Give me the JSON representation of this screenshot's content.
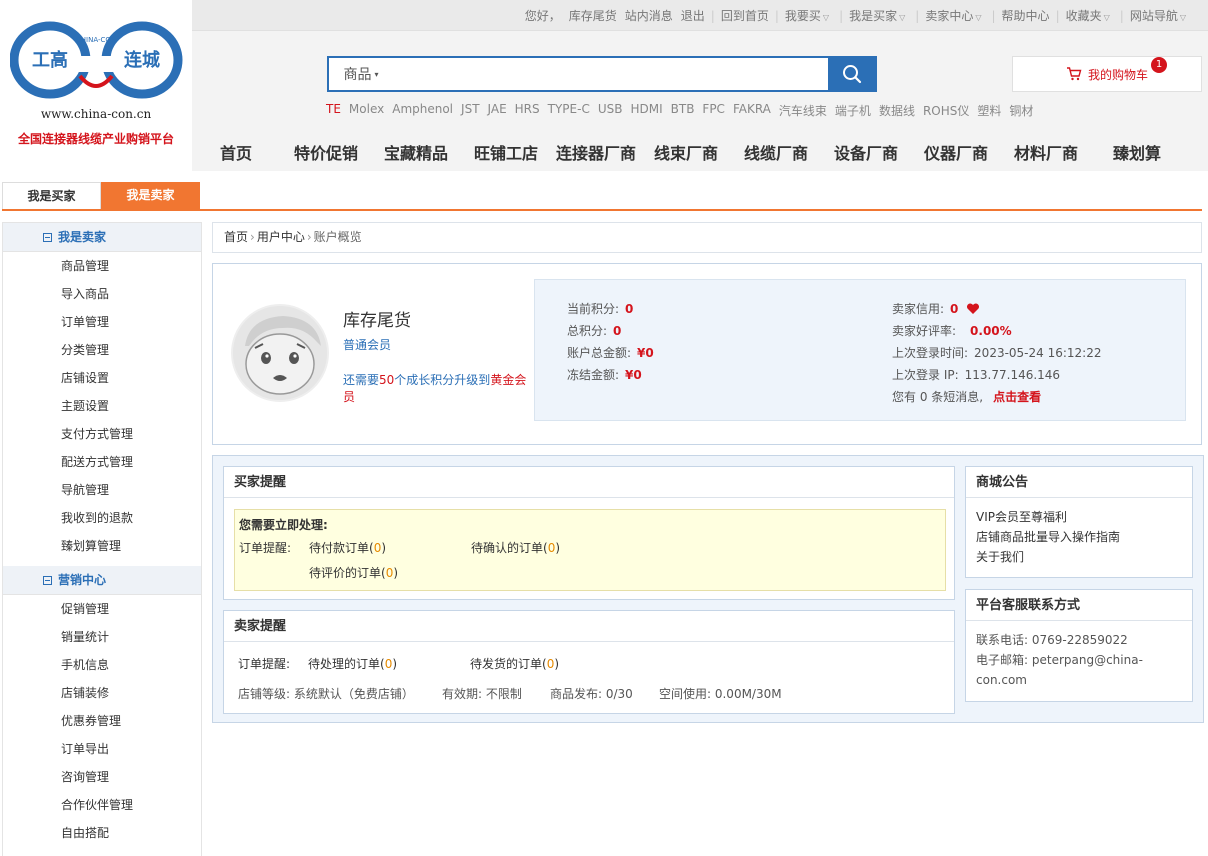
{
  "topbar": {
    "greeting": "您好，",
    "username": "库存尾货",
    "messages": "站内消息",
    "logout": "退出",
    "home": "回到首页",
    "want_buy": "我要买",
    "i_am_buyer": "我是买家",
    "seller_center": "卖家中心",
    "help": "帮助中心",
    "favorites": "收藏夹",
    "site_nav": "网站导航"
  },
  "logo": {
    "left_text": "工高",
    "mid_text": "CHINA-CON",
    "right_text": "连城",
    "url": "www.china-con.cn",
    "slogan": "全国连接器线缆产业购销平台",
    "colors": {
      "blue": "#2b6fb6",
      "red": "#d4141c"
    }
  },
  "search": {
    "category": "商品",
    "placeholder": "",
    "icon": "search-icon"
  },
  "hot_keywords": [
    "TE",
    "Molex",
    "Amphenol",
    "JST",
    "JAE",
    "HRS",
    "TYPE-C",
    "USB",
    "HDMI",
    "BTB",
    "FPC",
    "FAKRA",
    "汽车线束",
    "端子机",
    "数据线",
    "ROHS仪",
    "塑料",
    "铜材"
  ],
  "cart": {
    "label": "我的购物车",
    "count": "1",
    "icon": "cart-icon"
  },
  "main_nav": [
    "首页",
    "特价促销",
    "宝藏精品",
    "旺铺工店",
    "连接器厂商",
    "线束厂商",
    "线缆厂商",
    "设备厂商",
    "仪器厂商",
    "材料厂商",
    "臻划算"
  ],
  "role_tabs": {
    "buyer": "我是买家",
    "seller": "我是卖家"
  },
  "sidebar": {
    "groups": [
      {
        "title": "我是卖家",
        "items": [
          "商品管理",
          "导入商品",
          "订单管理",
          "分类管理",
          "店铺设置",
          "主题设置",
          "支付方式管理",
          "配送方式管理",
          "导航管理",
          "我收到的退款",
          "臻划算管理"
        ]
      },
      {
        "title": "营销中心",
        "items": [
          "促销管理",
          "销量统计",
          "手机信息",
          "店铺装修",
          "优惠券管理",
          "订单导出",
          "咨询管理",
          "合作伙伴管理",
          "自由搭配"
        ]
      }
    ]
  },
  "breadcrumb": {
    "home": "首页",
    "user_center": "用户中心",
    "current": "账户概览"
  },
  "profile": {
    "name": "库存尾货",
    "level": "普通会员",
    "note_prefix": "还需要",
    "note_points": "50",
    "note_mid": "个成长积分升级到",
    "note_target": "黄金会员",
    "stats_left": [
      {
        "label": "当前积分:",
        "value": "0"
      },
      {
        "label": "总积分:",
        "value": "0"
      },
      {
        "label": "账户总金额:",
        "value": "¥0"
      },
      {
        "label": "冻结金额:",
        "value": "¥0"
      }
    ],
    "credit_label": "卖家信用:",
    "credit_value": "0",
    "rate_label": "卖家好评率:",
    "rate_value": "0.00%",
    "last_login_label": "上次登录时间:",
    "last_login_value": "2023-05-24 16:12:22",
    "last_ip_label": "上次登录 IP:",
    "last_ip_value": "113.77.146.146",
    "msg_text": "您有 0 条短消息,",
    "msg_link": "点击查看"
  },
  "buyer_panel": {
    "title": "买家提醒",
    "urgent": "您需要立即处理:",
    "order_label": "订单提醒:",
    "pay_label": "待付款订单",
    "pay_count": "0",
    "confirm_label": "待确认的订单",
    "confirm_count": "0",
    "review_label": "待评价的订单",
    "review_count": "0"
  },
  "seller_panel": {
    "title": "卖家提醒",
    "order_label": "订单提醒:",
    "process_label": "待处理的订单",
    "process_count": "0",
    "ship_label": "待发货的订单",
    "ship_count": "0",
    "shop_level": "店铺等级: 系统默认（免费店铺）",
    "validity": "有效期: 不限制",
    "published": "商品发布: 0/30",
    "space": "空间使用: 0.00M/30M"
  },
  "notice_panel": {
    "title": "商城公告",
    "items": [
      "VIP会员至尊福利",
      "店铺商品批量导入操作指南",
      "关于我们"
    ]
  },
  "contact_panel": {
    "title": "平台客服联系方式",
    "phone": "联系电话: 0769-22859022",
    "email_line1": "电子邮箱: peterpang@china-",
    "email_line2": "con.com"
  }
}
